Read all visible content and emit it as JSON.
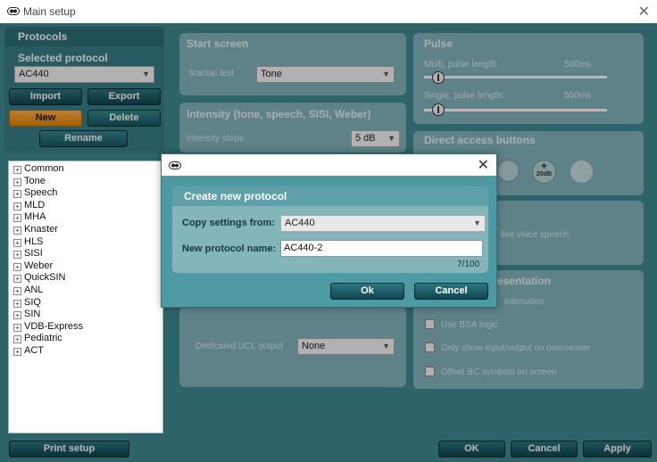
{
  "window": {
    "title": "Main setup",
    "close_glyph": "✕"
  },
  "protocols": {
    "title": "Protocols",
    "selected_label": "Selected protocol",
    "selected_value": "AC440",
    "buttons": {
      "import": "Import",
      "export": "Export",
      "new": "New",
      "delete": "Delete",
      "rename": "Rename"
    },
    "tree": [
      "Common",
      "Tone",
      "Speech",
      "MLD",
      "MHA",
      "Knaster",
      "HLS",
      "SISI",
      "Weber",
      "QuickSIN",
      "ANL",
      "SIQ",
      "SIN",
      "VDB-Express",
      "Pediatric",
      "ACT"
    ]
  },
  "start_screen": {
    "title": "Start screen",
    "startup_label": "Startup test",
    "startup_value": "Tone"
  },
  "intensity": {
    "title": "Intensity (tone, speech, SISI, Weber)",
    "steps_label": "Intensity steps",
    "steps_value": "5 dB"
  },
  "ucl": {
    "label": "Dedicated UCL output",
    "value": "None"
  },
  "pulse": {
    "title": "Pulse",
    "multi_label": "Multi, pulse length:",
    "multi_value": "500ms",
    "multi_level": 0.08,
    "single_label": "Single, pulse length:",
    "single_value": "500ms",
    "single_level": 0.08
  },
  "direct_access": {
    "title": "Direct access buttons",
    "plus_text": "+",
    "db_text": "20dB"
  },
  "live_voice": {
    "text": "live voice speech"
  },
  "presentation": {
    "title_fragment": "esentation",
    "intensities_fragment": "intensities",
    "options": [
      "Use BSA logic",
      "Only show input/output on mouseover",
      "Offset BC symbols on screen"
    ]
  },
  "footer": {
    "print_setup": "Print setup",
    "ok": "OK",
    "cancel": "Cancel",
    "apply": "Apply"
  },
  "dialog": {
    "close_glyph": "✕",
    "heading": "Create new protocol",
    "copy_label": "Copy settings from:",
    "copy_value": "AC440",
    "name_label": "New protocol name:",
    "name_value": "AC440-2",
    "counter": "7/100",
    "ok": "Ok",
    "cancel": "Cancel"
  },
  "icons": {
    "app": "hearing-aid-icon",
    "expander": "tree-expander-icon",
    "dropdown": "chevron-down-icon"
  }
}
